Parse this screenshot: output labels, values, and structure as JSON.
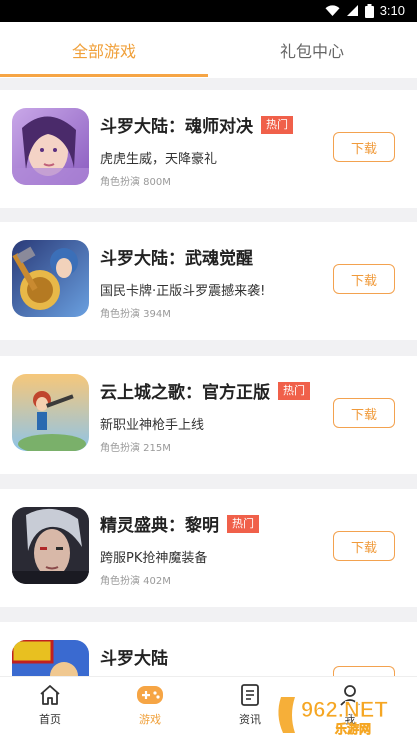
{
  "status_bar": {
    "time": "3:10"
  },
  "tabs": [
    {
      "label": "全部游戏",
      "active": true
    },
    {
      "label": "礼包中心",
      "active": false
    }
  ],
  "games": [
    {
      "title": "斗罗大陆：魂师对决",
      "badge": "热门",
      "desc": "虎虎生威，天降豪礼",
      "meta": "角色扮演 800M",
      "button": "下载"
    },
    {
      "title": "斗罗大陆：武魂觉醒",
      "badge": "",
      "desc": "国民卡牌·正版斗罗震撼来袭!",
      "meta": "角色扮演 394M",
      "button": "下载"
    },
    {
      "title": "云上城之歌：官方正版",
      "badge": "热门",
      "desc": "新职业神枪手上线",
      "meta": "角色扮演 215M",
      "button": "下载"
    },
    {
      "title": "精灵盛典：黎明",
      "badge": "热门",
      "desc": "跨服PK抢神魔装备",
      "meta": "角色扮演 402M",
      "button": "下载"
    },
    {
      "title": "斗罗大陆",
      "badge": "",
      "desc": "",
      "meta": "",
      "button": ""
    }
  ],
  "bottom_nav": [
    {
      "label": "首页",
      "icon": "home-icon"
    },
    {
      "label": "游戏",
      "icon": "gamepad-icon"
    },
    {
      "label": "资讯",
      "icon": "news-icon"
    },
    {
      "label": "我",
      "icon": "user-icon"
    }
  ],
  "watermark": {
    "text_top": "962.NET",
    "text_bottom": "乐游网"
  },
  "colors": {
    "accent": "#f6a545",
    "badge": "#f0604a",
    "text_dark": "#222222",
    "text_gray": "#999999"
  }
}
